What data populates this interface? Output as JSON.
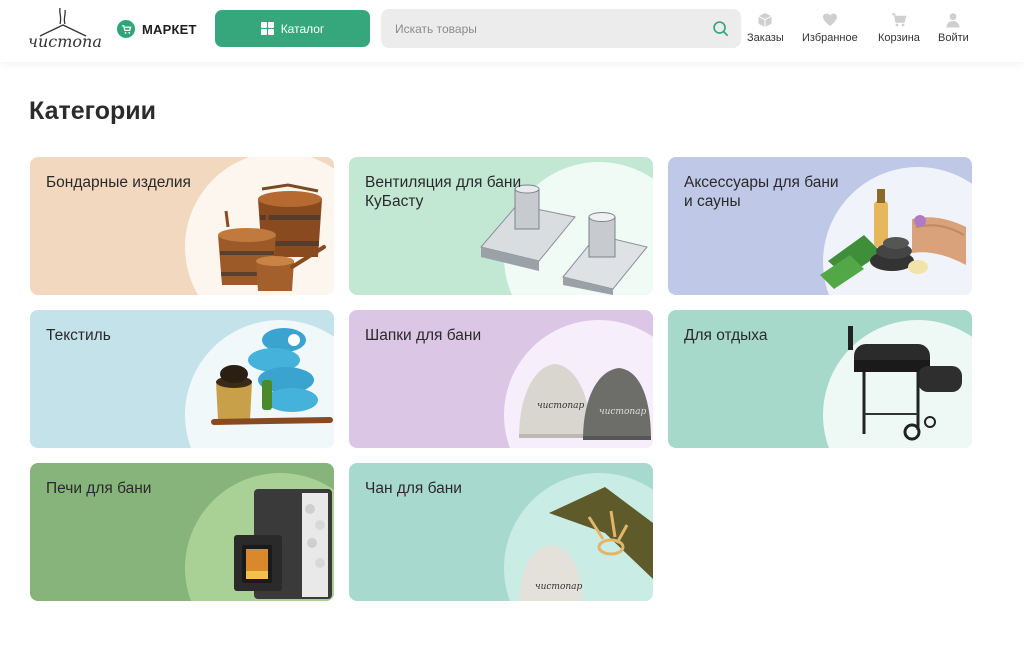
{
  "header": {
    "logo_text": "чистопар",
    "market_label": "МАРКЕТ",
    "catalog_label": "Каталог",
    "search_placeholder": "Искать товары",
    "nav": [
      {
        "label": "Заказы",
        "icon": "box-icon"
      },
      {
        "label": "Избранное",
        "icon": "heart-icon"
      },
      {
        "label": "Корзина",
        "icon": "cart-icon"
      },
      {
        "label": "Войти",
        "icon": "user-icon"
      }
    ]
  },
  "page": {
    "title": "Категории"
  },
  "categories": [
    {
      "label": "Бондарные изделия",
      "bg": "#f1d8be",
      "circle": "#fdf6ef"
    },
    {
      "label": "Вентиляция для бани КуБасту",
      "bg": "#c2e8d4",
      "circle": "#f0fbf6"
    },
    {
      "label": "Аксессуары для бани и сауны",
      "bg": "#bfc8e7",
      "circle": "#f1f3fb"
    },
    {
      "label": "Текстиль",
      "bg": "#c4e2ea",
      "circle": "#f0f8fa"
    },
    {
      "label": "Шапки для бани",
      "bg": "#dbc6e6",
      "circle": "#f6eefa"
    },
    {
      "label": "Для отдыха",
      "bg": "#a7d9ca",
      "circle": "#eef9f5"
    },
    {
      "label": "Печи для бани",
      "bg": "#86b47a",
      "circle": "#a9d196"
    },
    {
      "label": "Чан для бани",
      "bg": "#a8d9cf",
      "circle": "#c9ece5"
    }
  ],
  "colors": {
    "accent": "#36a77c",
    "text": "#2b2b2b",
    "search_bg": "#ececec"
  }
}
